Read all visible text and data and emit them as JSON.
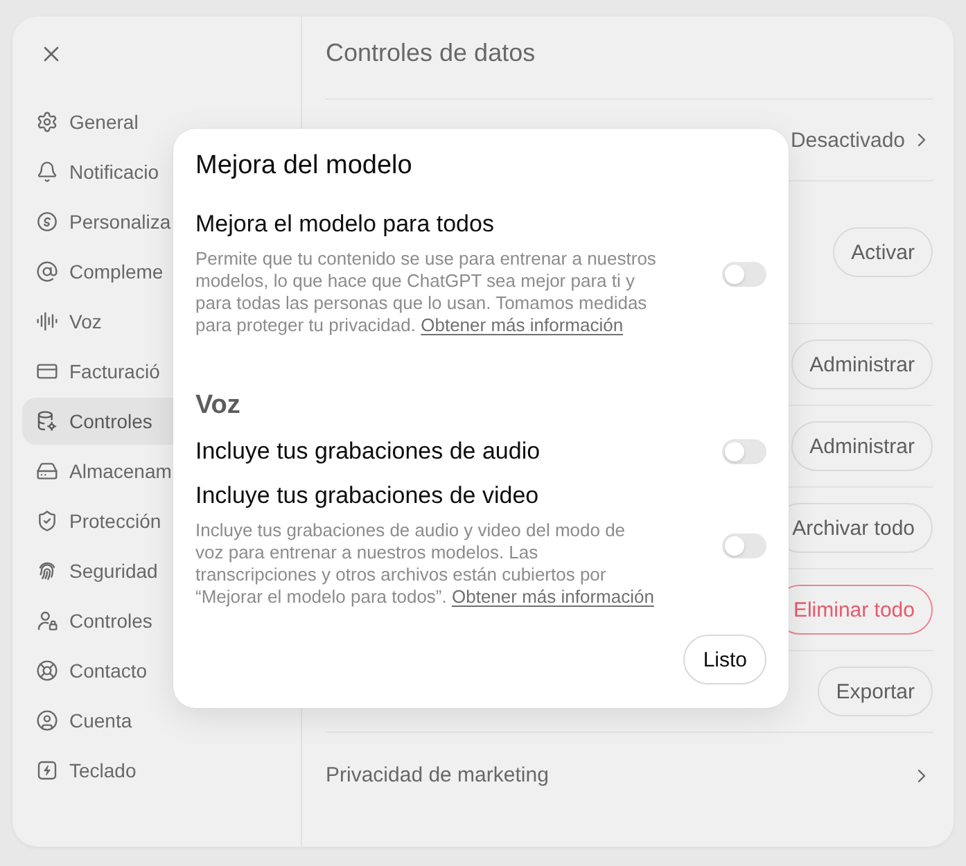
{
  "sidebar": {
    "items": [
      {
        "label": "General",
        "selected": false
      },
      {
        "label": "Notificacio",
        "selected": false
      },
      {
        "label": "Personaliza",
        "selected": false
      },
      {
        "label": "Compleme",
        "selected": false
      },
      {
        "label": "Voz",
        "selected": false
      },
      {
        "label": "Facturació",
        "selected": false
      },
      {
        "label": "Controles",
        "selected": true
      },
      {
        "label": "Almacenam",
        "selected": false
      },
      {
        "label": "Protección",
        "selected": false
      },
      {
        "label": "Seguridad",
        "selected": false
      },
      {
        "label": "Controles",
        "selected": false
      },
      {
        "label": "Contacto",
        "selected": false
      },
      {
        "label": "Cuenta",
        "selected": false
      },
      {
        "label": "Teclado",
        "selected": false
      }
    ]
  },
  "content": {
    "title": "Controles de datos",
    "rows": [
      {
        "kind": "value",
        "value": "Desactivado"
      },
      {
        "kind": "tall-action",
        "button": "Activar"
      },
      {
        "kind": "action",
        "button": "Administrar"
      },
      {
        "kind": "action",
        "button": "Administrar"
      },
      {
        "kind": "action",
        "button": "Archivar todo"
      },
      {
        "kind": "danger-action",
        "button": "Eliminar todo"
      },
      {
        "kind": "action",
        "button": "Exportar"
      },
      {
        "kind": "link",
        "label": "Privacidad de marketing"
      }
    ]
  },
  "dialog": {
    "title": "Mejora del modelo",
    "sections": [
      {
        "settings": [
          {
            "title": "Mejora el modelo para todos",
            "description": "Permite que tu contenido se use para entrenar a nuestros modelos, lo que hace que ChatGPT sea mejor para ti y para todas las personas que lo usan. Tomamos medidas para proteger tu privacidad.",
            "link": "Obtener más información",
            "on": false
          }
        ]
      },
      {
        "heading": "Voz",
        "settings": [
          {
            "title": "Incluye tus grabaciones de audio",
            "on": false
          },
          {
            "title": "Incluye tus grabaciones de video",
            "description": "Incluye tus grabaciones de audio y video del modo de voz para entrenar a nuestros modelos. Las transcripciones y otros archivos están cubiertos por “Mejorar el modelo para todos”.",
            "link": "Obtener más información",
            "on": false
          }
        ]
      }
    ],
    "done_button": "Listo"
  }
}
